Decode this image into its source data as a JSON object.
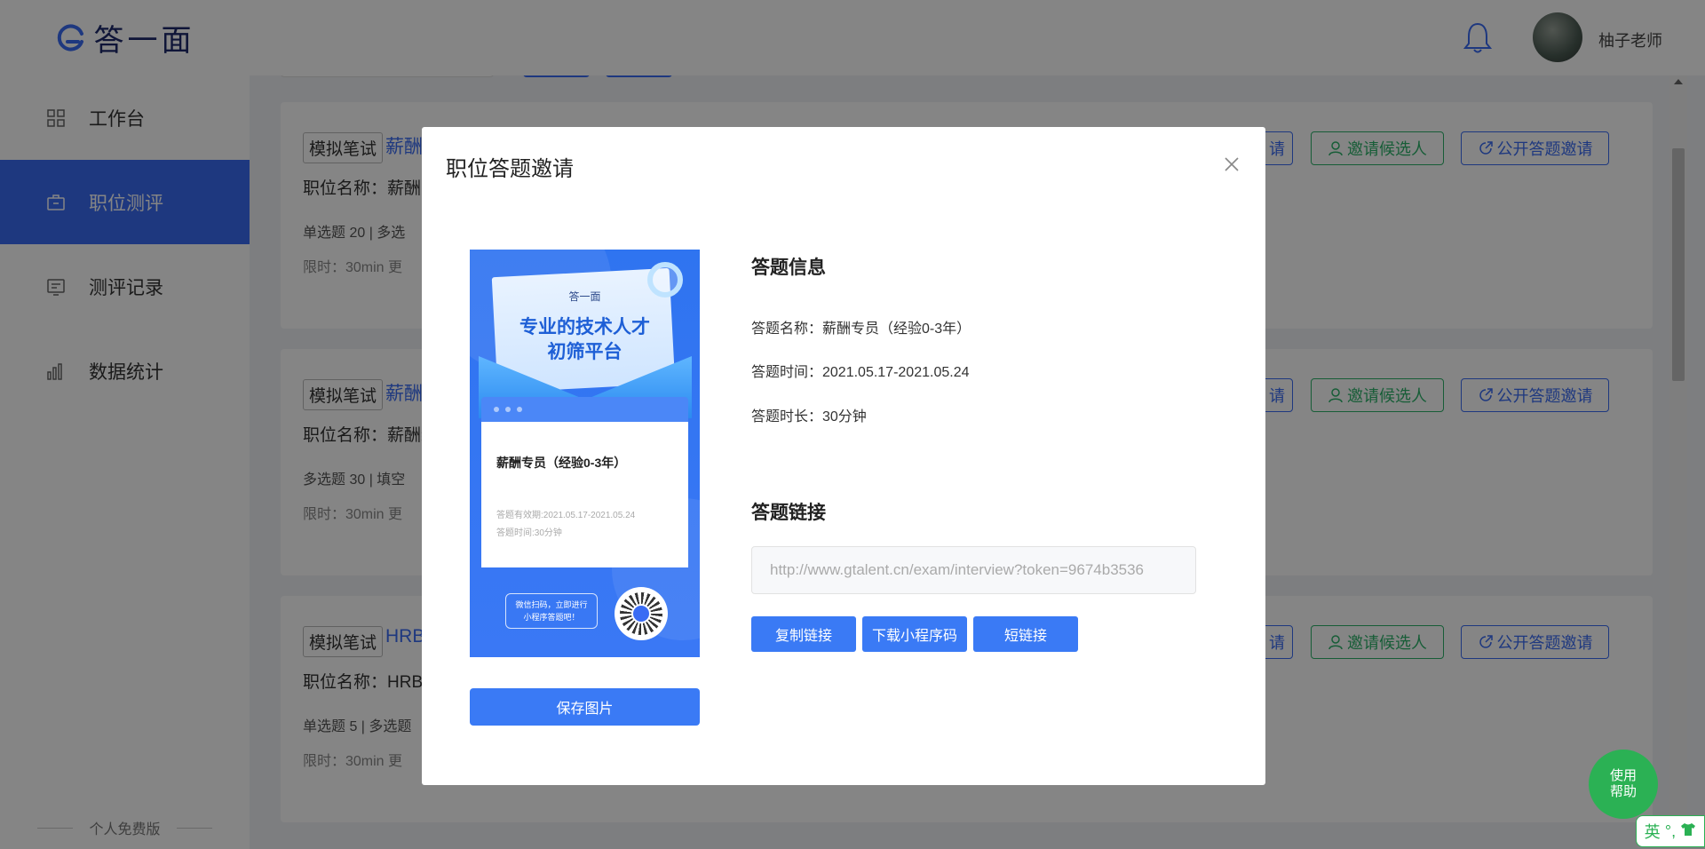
{
  "sidebar": {
    "logo_text": "答一面",
    "items": [
      {
        "label": "工作台",
        "icon": "grid-icon"
      },
      {
        "label": "职位测评",
        "icon": "briefcase-icon",
        "active": true
      },
      {
        "label": "测评记录",
        "icon": "record-icon"
      },
      {
        "label": "数据统计",
        "icon": "bar-chart-icon"
      }
    ],
    "footer": "个人免费版"
  },
  "header": {
    "username": "柚子老师"
  },
  "cards": [
    {
      "tag": "模拟笔试",
      "title": "薪酬",
      "position": "职位名称：薪酬专",
      "counts": "单选题 20   |   多选",
      "limit": "限时：30min     更",
      "btn_a": "请",
      "btn_invite": "邀请候选人",
      "btn_public": "公开答题邀请"
    },
    {
      "tag": "模拟笔试",
      "title": "薪酬",
      "position": "职位名称：薪酬绩",
      "counts": "多选题 30   |   填空",
      "limit": "限时：30min     更",
      "btn_a": "请",
      "btn_invite": "邀请候选人",
      "btn_public": "公开答题邀请"
    },
    {
      "tag": "模拟笔试",
      "title": "HRB",
      "position": "职位名称：HRBP",
      "counts": "单选题 5   |   多选题",
      "limit": "限时：30min     更",
      "btn_a": "请",
      "btn_invite": "邀请候选人",
      "btn_public": "公开答题邀请"
    }
  ],
  "modal": {
    "title": "职位答题邀请",
    "poster": {
      "logo": "答一面",
      "headline_1": "专业的技术人才",
      "headline_2": "初筛平台",
      "card_title": "薪酬专员（经验0-3年）",
      "valid": "答题有效期:2021.05.17-2021.05.24",
      "time": "答题时间:30分钟",
      "bubble_1": "微信扫码，立即进行",
      "bubble_2": "小程序答题吧！"
    },
    "save_button": "保存图片",
    "info_title": "答题信息",
    "info_name": "答题名称：薪酬专员（经验0-3年）",
    "info_time": "答题时间：2021.05.17-2021.05.24",
    "info_duration": "答题时长：30分钟",
    "link_title": "答题链接",
    "link_value": "http://www.gtalent.cn/exam/interview?token=9674b3536",
    "copy_button": "复制链接",
    "download_button": "下载小程序码",
    "short_button": "短链接"
  },
  "help": {
    "line1": "使用",
    "line2": "帮助"
  },
  "ime": {
    "lang": "英",
    "punct": "°,"
  },
  "colors": {
    "primary": "#3a6cf4",
    "success": "#2bb154"
  }
}
